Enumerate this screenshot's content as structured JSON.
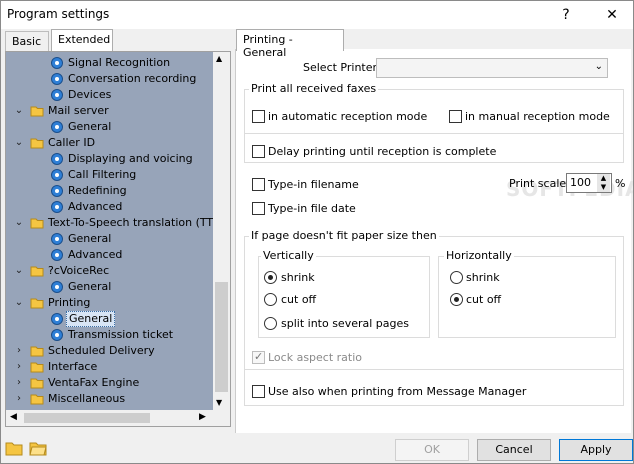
{
  "window": {
    "title": "Program settings",
    "help_label": "?",
    "close_label": "✕"
  },
  "tabs": [
    {
      "label": "Basic",
      "active": false
    },
    {
      "label": "Extended",
      "active": true
    }
  ],
  "tree": {
    "items": [
      {
        "label": "Signal Recognition",
        "icon": "gear-icon",
        "level": 2,
        "expander": "",
        "selected": false
      },
      {
        "label": "Conversation recording",
        "icon": "gear-icon",
        "level": 2,
        "expander": "",
        "selected": false
      },
      {
        "label": "Devices",
        "icon": "gear-icon",
        "level": 2,
        "expander": "",
        "selected": false
      },
      {
        "label": "Mail server",
        "icon": "folder-icon",
        "level": 1,
        "expander": "expanded",
        "selected": false
      },
      {
        "label": "General",
        "icon": "gear-icon",
        "level": 2,
        "expander": "",
        "selected": false
      },
      {
        "label": "Caller ID",
        "icon": "folder-icon",
        "level": 1,
        "expander": "expanded",
        "selected": false
      },
      {
        "label": "Displaying and voicing",
        "icon": "gear-icon",
        "level": 2,
        "expander": "",
        "selected": false
      },
      {
        "label": "Call Filtering",
        "icon": "gear-icon",
        "level": 2,
        "expander": "",
        "selected": false
      },
      {
        "label": "Redefining",
        "icon": "gear-icon",
        "level": 2,
        "expander": "",
        "selected": false
      },
      {
        "label": "Advanced",
        "icon": "gear-icon",
        "level": 2,
        "expander": "",
        "selected": false
      },
      {
        "label": "Text-To-Speech translation (TTS)",
        "icon": "folder-icon",
        "level": 1,
        "expander": "expanded",
        "selected": false
      },
      {
        "label": "General",
        "icon": "gear-icon",
        "level": 2,
        "expander": "",
        "selected": false
      },
      {
        "label": "Advanced",
        "icon": "gear-icon",
        "level": 2,
        "expander": "",
        "selected": false
      },
      {
        "label": "?cVoiceRec",
        "icon": "folder-icon",
        "level": 1,
        "expander": "expanded",
        "selected": false
      },
      {
        "label": "General",
        "icon": "gear-icon",
        "level": 2,
        "expander": "",
        "selected": false
      },
      {
        "label": "Printing",
        "icon": "folder-icon",
        "level": 1,
        "expander": "expanded",
        "selected": false
      },
      {
        "label": "General",
        "icon": "gear-icon",
        "level": 2,
        "expander": "",
        "selected": true
      },
      {
        "label": "Transmission ticket",
        "icon": "gear-icon",
        "level": 2,
        "expander": "",
        "selected": false
      },
      {
        "label": "Scheduled Delivery",
        "icon": "folder-icon",
        "level": 1,
        "expander": "collapsed",
        "selected": false
      },
      {
        "label": "Interface",
        "icon": "folder-icon",
        "level": 1,
        "expander": "collapsed",
        "selected": false
      },
      {
        "label": "VentaFax Engine",
        "icon": "folder-icon",
        "level": 1,
        "expander": "collapsed",
        "selected": false
      },
      {
        "label": "Miscellaneous",
        "icon": "folder-icon",
        "level": 1,
        "expander": "collapsed",
        "selected": false
      }
    ]
  },
  "panel": {
    "tab_label": "Printing - General",
    "select_printer_label": "Select Printer",
    "select_printer_value": "",
    "all_faxes": {
      "title": "Print all received faxes",
      "auto_label": "in automatic reception mode",
      "manual_label": "in manual reception mode",
      "delay_label": "Delay printing until reception is complete"
    },
    "typein_filename_label": "Type-in filename",
    "typein_filedate_label": "Type-in file date",
    "print_scale_label": "Print scale",
    "print_scale_value": "100",
    "print_scale_unit": "%",
    "fit": {
      "title": "If page doesn't fit paper size then",
      "vertical": {
        "title": "Vertically",
        "options": [
          "shrink",
          "cut off",
          "split into several pages"
        ],
        "selected": 0
      },
      "horizontal": {
        "title": "Horizontally",
        "options": [
          "shrink",
          "cut off"
        ],
        "selected": 1
      },
      "lock_aspect_label": "Lock aspect ratio",
      "use_also_label": "Use also when printing from Message Manager"
    }
  },
  "footer": {
    "ok_label": "OK",
    "cancel_label": "Cancel",
    "apply_label": "Apply"
  },
  "colors": {
    "tree_bg": "#97a4b9",
    "accent": "#0078d7"
  }
}
